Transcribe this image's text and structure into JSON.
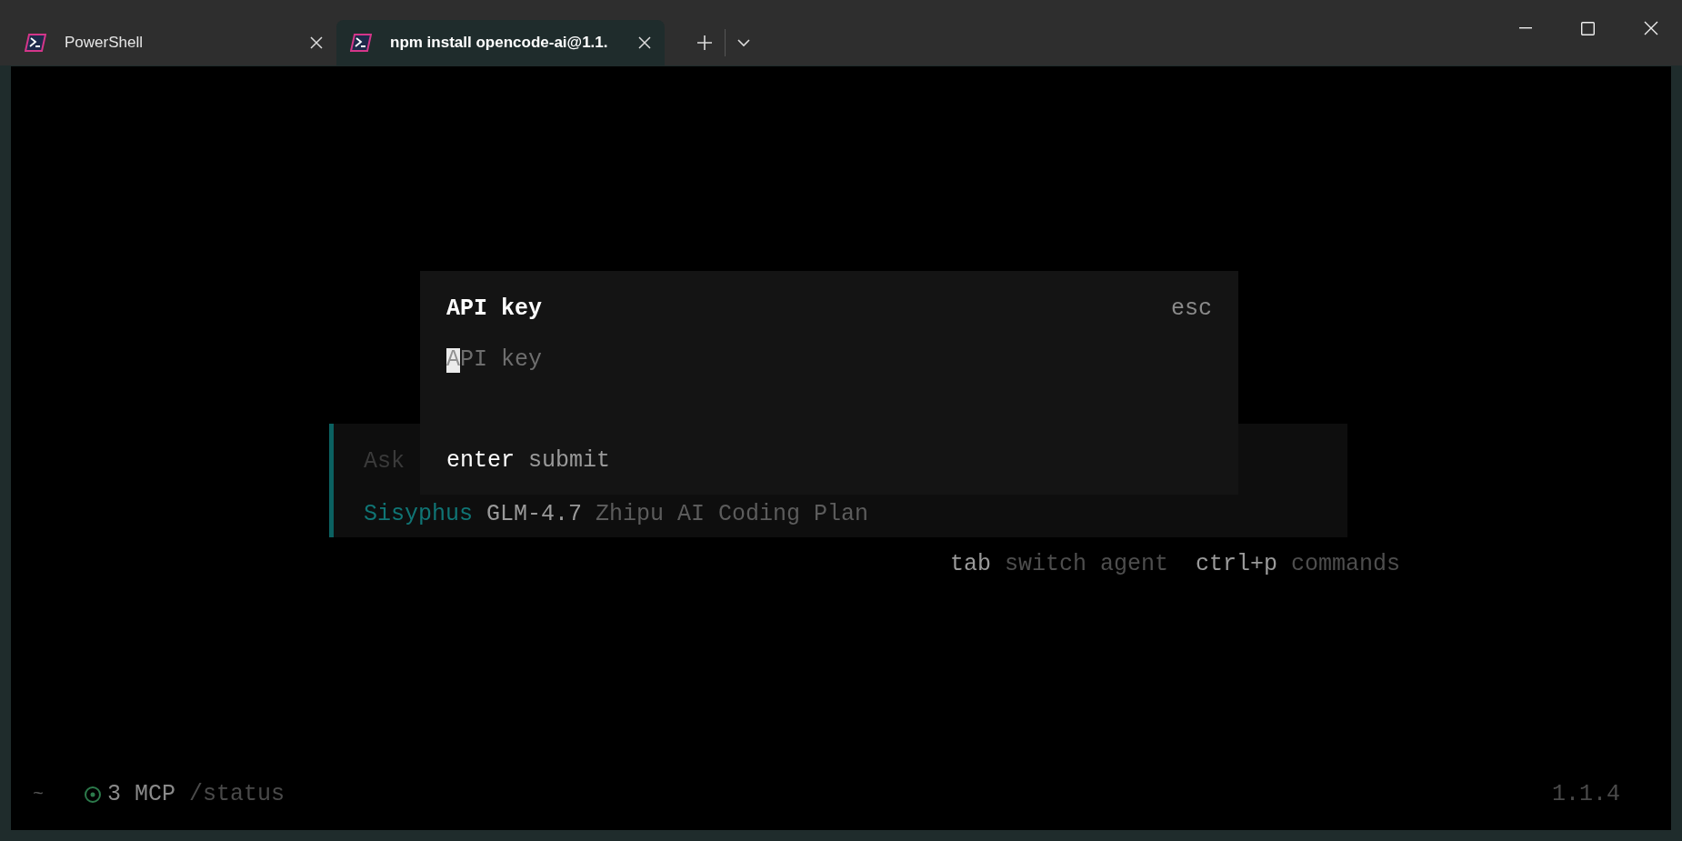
{
  "tabs": [
    {
      "label": "PowerShell",
      "selected": false
    },
    {
      "label": "npm install opencode-ai@1.1.",
      "selected": true
    }
  ],
  "dialog": {
    "title": "API key",
    "close_hint": "esc",
    "input": {
      "placeholder": "API key"
    },
    "footer": [
      {
        "key": "enter",
        "action": "submit"
      }
    ]
  },
  "prompt": {
    "placeholder": "Ask",
    "agent": "Sisyphus",
    "model": "GLM-4.7",
    "provider": "Zhipu AI Coding Plan"
  },
  "hints": [
    {
      "key": "tab",
      "action": "switch agent"
    },
    {
      "key": "ctrl+p",
      "action": "commands"
    }
  ],
  "status_bar": {
    "path": "~",
    "mcp": "3 MCP",
    "command": "/status",
    "version": "1.1.4"
  }
}
